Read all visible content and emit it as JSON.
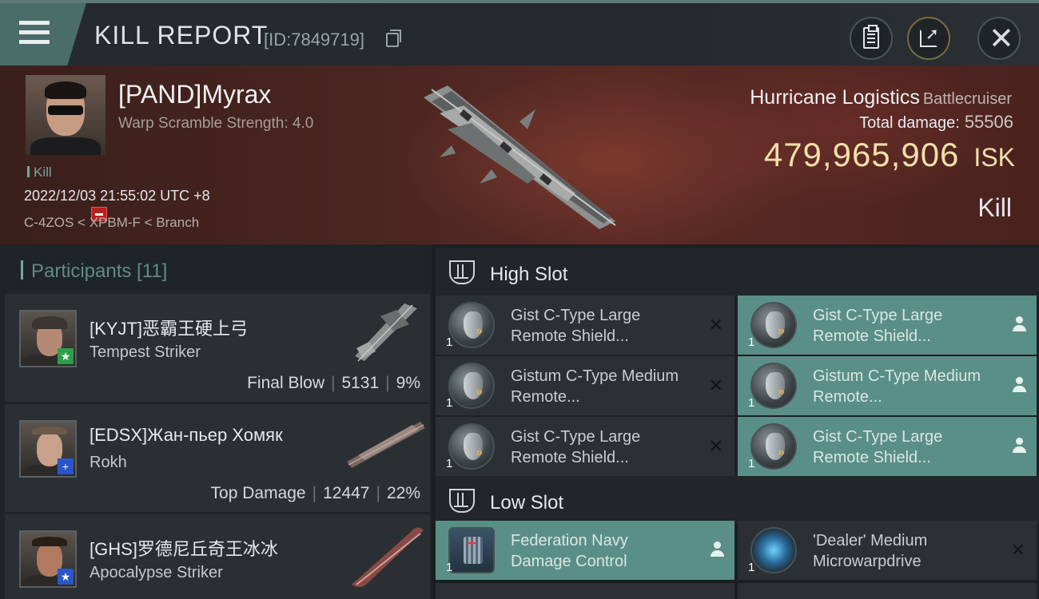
{
  "header": {
    "title": "KILL REPORT",
    "report_id": "[ID:7849719]"
  },
  "victim": {
    "name": "[PAND]Myrax",
    "detail": "Warp Scramble Strength: 4.0",
    "result_tag": "Kill",
    "datetime": "2022/12/03 21:55:02 UTC +8",
    "location": "C-4ZOS < XPBM-F < Branch",
    "ship_name": "Hurricane Logistics",
    "ship_class": "Battlecruiser",
    "damage_label": "Total damage:",
    "damage_value": "55506",
    "isk_amount": "479,965,906",
    "isk_unit": "ISK",
    "kill_label": "Kill"
  },
  "participants": {
    "title": "Participants [11]",
    "rows": [
      {
        "name": "[KYJT]恶霸王硬上弓",
        "ship": "Tempest Striker",
        "role": "Final Blow",
        "damage": "5131",
        "percent": "9%",
        "badge": "★",
        "badge_color": "#2f9e4a"
      },
      {
        "name": "[EDSX]Жан-пьер Хомяк",
        "ship": "Rokh",
        "role": "Top Damage",
        "damage": "12447",
        "percent": "22%",
        "badge": "+",
        "badge_color": "#2a55c4"
      },
      {
        "name": "[GHS]罗德尼丘奇王冰冰",
        "ship": "Apocalypse Striker",
        "role": "",
        "damage": "",
        "percent": "",
        "badge": "★",
        "badge_color": "#2a55c4"
      }
    ]
  },
  "slots": {
    "high_label": "High Slot",
    "low_label": "Low Slot",
    "high": [
      {
        "name": "Gist C-Type Large Remote Shield...",
        "qty": "1",
        "status": "destroyed",
        "icon": "shield-booster-icon"
      },
      {
        "name": "Gist C-Type Large Remote Shield...",
        "qty": "1",
        "status": "dropped",
        "icon": "shield-booster-icon"
      },
      {
        "name": "Gistum C-Type Medium Remote...",
        "qty": "1",
        "status": "destroyed",
        "icon": "shield-booster-icon"
      },
      {
        "name": "Gistum C-Type Medium Remote...",
        "qty": "1",
        "status": "dropped",
        "icon": "shield-booster-icon"
      },
      {
        "name": "Gist C-Type Large Remote Shield...",
        "qty": "1",
        "status": "destroyed",
        "icon": "shield-booster-icon"
      },
      {
        "name": "Gist C-Type Large Remote Shield...",
        "qty": "1",
        "status": "dropped",
        "icon": "shield-booster-icon"
      }
    ],
    "low": [
      {
        "name": "Federation Navy Damage Control",
        "qty": "1",
        "status": "dropped",
        "icon": "damage-control-icon"
      },
      {
        "name": "'Dealer' Medium Microwarpdrive",
        "qty": "1",
        "status": "destroyed",
        "icon": "microwarpdrive-icon"
      }
    ]
  }
}
